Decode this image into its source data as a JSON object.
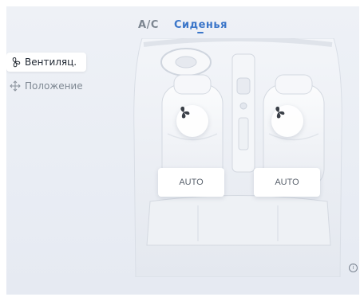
{
  "tabs": [
    {
      "label": "A/C",
      "active": false
    },
    {
      "label": "Сиденья",
      "active": true
    }
  ],
  "side_menu": [
    {
      "label": "Вентиляц.",
      "icon": "fan-icon",
      "active": true
    },
    {
      "label": "Положение",
      "icon": "move-arrows-icon",
      "active": false
    }
  ],
  "seats": {
    "left": {
      "mode": "AUTO",
      "icon": "fan-icon"
    },
    "right": {
      "mode": "AUTO",
      "icon": "fan-icon"
    }
  },
  "info_icon": "info-icon",
  "colors": {
    "accent": "#3b76c9",
    "background": "#eef1f6",
    "inactive_text": "#7c8590"
  }
}
